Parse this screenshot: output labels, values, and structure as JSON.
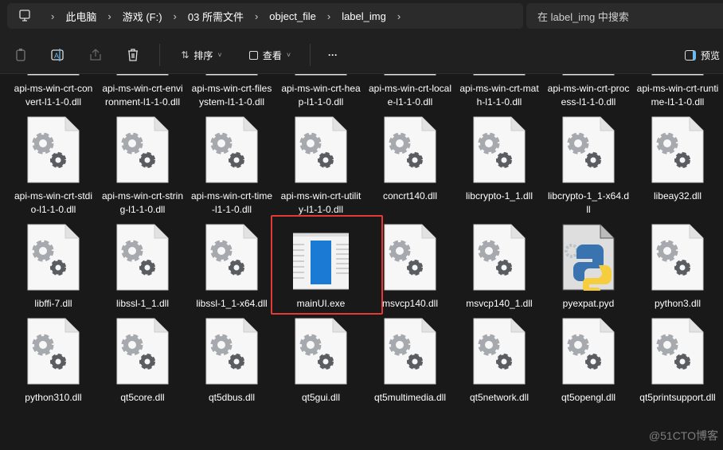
{
  "breadcrumb": [
    "此电脑",
    "游戏 (F:)",
    "03 所需文件",
    "object_file",
    "label_img"
  ],
  "search": {
    "placeholder": "在 label_img 中搜索"
  },
  "toolbar": {
    "sort_label": "排序",
    "view_label": "查看",
    "more_label": "···",
    "preview_label": "预览"
  },
  "files": [
    {
      "name": "api-ms-win-crt-convert-l1-1-0.dll",
      "type": "dll"
    },
    {
      "name": "api-ms-win-crt-environment-l1-1-0.dll",
      "type": "dll"
    },
    {
      "name": "api-ms-win-crt-filesystem-l1-1-0.dll",
      "type": "dll"
    },
    {
      "name": "api-ms-win-crt-heap-l1-1-0.dll",
      "type": "dll"
    },
    {
      "name": "api-ms-win-crt-locale-l1-1-0.dll",
      "type": "dll"
    },
    {
      "name": "api-ms-win-crt-math-l1-1-0.dll",
      "type": "dll"
    },
    {
      "name": "api-ms-win-crt-process-l1-1-0.dll",
      "type": "dll"
    },
    {
      "name": "api-ms-win-crt-runtime-l1-1-0.dll",
      "type": "dll"
    },
    {
      "name": "api-ms-win-crt-stdio-l1-1-0.dll",
      "type": "dll"
    },
    {
      "name": "api-ms-win-crt-string-l1-1-0.dll",
      "type": "dll"
    },
    {
      "name": "api-ms-win-crt-time-l1-1-0.dll",
      "type": "dll"
    },
    {
      "name": "api-ms-win-crt-utility-l1-1-0.dll",
      "type": "dll"
    },
    {
      "name": "concrt140.dll",
      "type": "dll"
    },
    {
      "name": "libcrypto-1_1.dll",
      "type": "dll"
    },
    {
      "name": "libcrypto-1_1-x64.dll",
      "type": "dll"
    },
    {
      "name": "libeay32.dll",
      "type": "dll"
    },
    {
      "name": "libffi-7.dll",
      "type": "dll"
    },
    {
      "name": "libssl-1_1.dll",
      "type": "dll"
    },
    {
      "name": "libssl-1_1-x64.dll",
      "type": "dll"
    },
    {
      "name": "mainUI.exe",
      "type": "exe",
      "highlighted": true
    },
    {
      "name": "msvcp140.dll",
      "type": "dll"
    },
    {
      "name": "msvcp140_1.dll",
      "type": "dll"
    },
    {
      "name": "pyexpat.pyd",
      "type": "pyd"
    },
    {
      "name": "python3.dll",
      "type": "dll"
    },
    {
      "name": "python310.dll",
      "type": "dll"
    },
    {
      "name": "qt5core.dll",
      "type": "dll"
    },
    {
      "name": "qt5dbus.dll",
      "type": "dll"
    },
    {
      "name": "qt5gui.dll",
      "type": "dll"
    },
    {
      "name": "qt5multimedia.dll",
      "type": "dll"
    },
    {
      "name": "qt5network.dll",
      "type": "dll"
    },
    {
      "name": "qt5opengl.dll",
      "type": "dll"
    },
    {
      "name": "qt5printsupport.dll",
      "type": "dll"
    }
  ],
  "watermark": "@51CTO博客",
  "colors": {
    "highlight": "#e53935",
    "accent": "#0078d4"
  }
}
